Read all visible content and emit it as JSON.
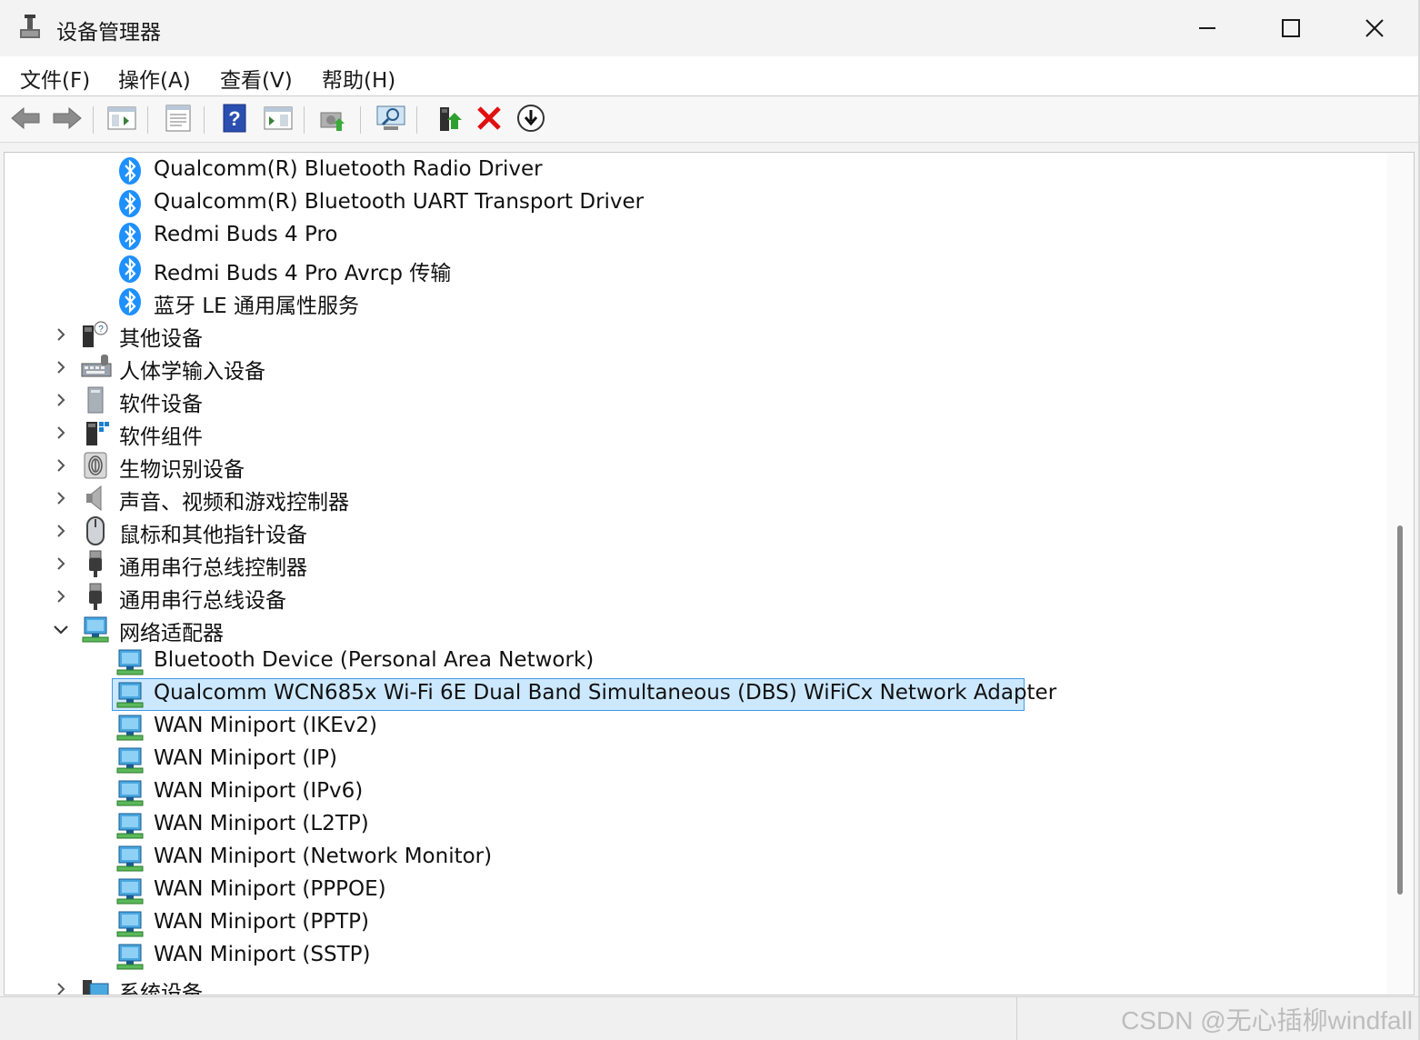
{
  "window": {
    "title": "设备管理器"
  },
  "menu": [
    {
      "label": "文件(F)"
    },
    {
      "label": "操作(A)"
    },
    {
      "label": "查看(V)"
    },
    {
      "label": "帮助(H)"
    }
  ],
  "toolbar": [
    {
      "name": "back-icon"
    },
    {
      "name": "forward-icon"
    },
    {
      "name": "show-hide-console-tree-icon"
    },
    {
      "name": "properties-icon"
    },
    {
      "name": "help-icon"
    },
    {
      "name": "show-action-pane-icon"
    },
    {
      "name": "update-driver-icon"
    },
    {
      "name": "scan-hardware-changes-icon"
    },
    {
      "name": "enable-device-icon"
    },
    {
      "name": "uninstall-device-icon"
    },
    {
      "name": "disable-device-icon"
    }
  ],
  "tree": {
    "bluetooth_children": [
      "Qualcomm(R) Bluetooth Radio Driver",
      "Qualcomm(R) Bluetooth UART Transport Driver",
      "Redmi Buds 4 Pro",
      "Redmi Buds 4 Pro Avrcp 传输",
      "蓝牙 LE 通用属性服务"
    ],
    "categories": [
      {
        "label": "其他设备",
        "icon": "other-devices-icon"
      },
      {
        "label": "人体学输入设备",
        "icon": "hid-icon"
      },
      {
        "label": "软件设备",
        "icon": "software-device-icon"
      },
      {
        "label": "软件组件",
        "icon": "software-component-icon"
      },
      {
        "label": "生物识别设备",
        "icon": "biometric-icon"
      },
      {
        "label": "声音、视频和游戏控制器",
        "icon": "speaker-icon"
      },
      {
        "label": "鼠标和其他指针设备",
        "icon": "mouse-icon"
      },
      {
        "label": "通用串行总线控制器",
        "icon": "usb-icon"
      },
      {
        "label": "通用串行总线设备",
        "icon": "usb-icon"
      }
    ],
    "network_category": "网络适配器",
    "network_children": [
      "Bluetooth Device (Personal Area Network)",
      "Qualcomm WCN685x Wi-Fi 6E Dual Band Simultaneous (DBS) WiFiCx Network Adapter",
      "WAN Miniport (IKEv2)",
      "WAN Miniport (IP)",
      "WAN Miniport (IPv6)",
      "WAN Miniport (L2TP)",
      "WAN Miniport (Network Monitor)",
      "WAN Miniport (PPPOE)",
      "WAN Miniport (PPTP)",
      "WAN Miniport (SSTP)"
    ],
    "selected_index": 1,
    "last_category": "系统设备"
  },
  "watermark": "CSDN @无心插柳windfall",
  "colors": {
    "selection_bg": "#cce8ff",
    "selection_border": "#3f9ae6",
    "bluetooth_blue": "#1e90ff"
  }
}
